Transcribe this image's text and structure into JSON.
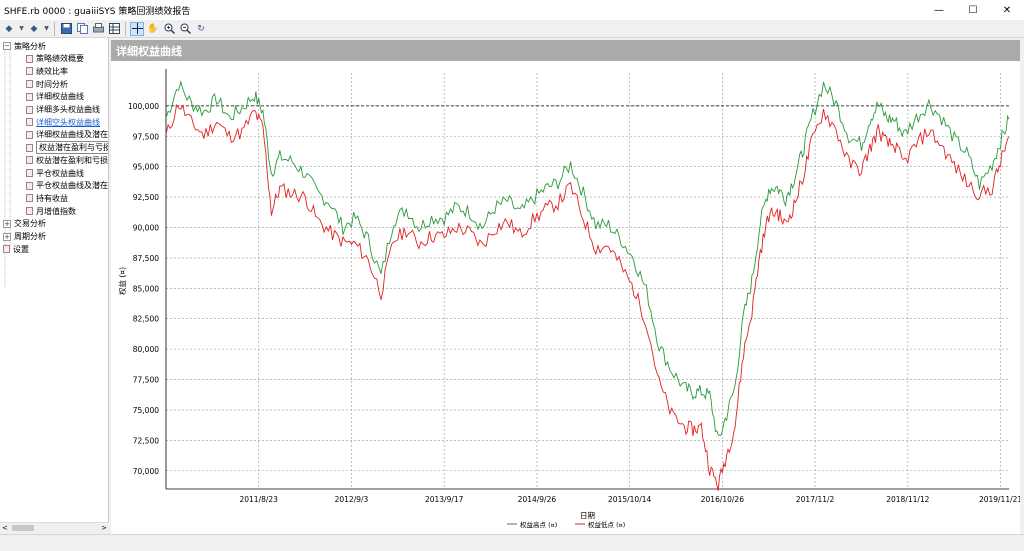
{
  "window": {
    "title": "SHFE.rb 0000 : guaiiiSYS 策略回测绩效报告",
    "minimize": "—",
    "maximize": "☐",
    "close": "✕"
  },
  "toolbar": {
    "icons": [
      "back-arrow-icon",
      "dropdown-icon",
      "forward-arrow-icon",
      "dropdown-icon",
      "save-icon",
      "copy-icon",
      "print-icon",
      "table-icon",
      "crosshair-icon",
      "hand-pan-icon",
      "zoom-in-icon",
      "zoom-out-icon",
      "refresh-icon"
    ]
  },
  "tree": {
    "items": [
      {
        "label": "策略分析",
        "level": 0,
        "expander": "−"
      },
      {
        "label": "策略绩效概要",
        "level": 1
      },
      {
        "label": "绩效比率",
        "level": 1
      },
      {
        "label": "时间分析",
        "level": 1
      },
      {
        "label": "详细权益曲线",
        "level": 1
      },
      {
        "label": "详细多头权益曲线",
        "level": 1
      },
      {
        "label": "详细空头权益曲线",
        "level": 1,
        "selected": true
      },
      {
        "label": "详细权益曲线及潜在",
        "level": 1
      },
      {
        "label": "权益潜在盈利与亏损",
        "level": 1,
        "hover": true
      },
      {
        "label": "权益潜在盈利和亏损",
        "level": 1
      },
      {
        "label": "平仓权益曲线",
        "level": 1
      },
      {
        "label": "平仓权益曲线及潜在",
        "level": 1
      },
      {
        "label": "持有收益",
        "level": 1
      },
      {
        "label": "月增值指数",
        "level": 1
      },
      {
        "label": "交易分析",
        "level": 0,
        "expander": "+"
      },
      {
        "label": "周期分析",
        "level": 0,
        "expander": "+"
      },
      {
        "label": "设置",
        "level": 0
      }
    ]
  },
  "panel": {
    "title": "详细权益曲线"
  },
  "chart_data": {
    "type": "line",
    "title": "",
    "xlabel": "日期",
    "ylabel": "权益 (¤)",
    "ylim": [
      68500,
      102700
    ],
    "yticks": [
      "70,000",
      "72,500",
      "75,000",
      "77,500",
      "80,000",
      "82,500",
      "85,000",
      "87,500",
      "90,000",
      "92,500",
      "95,000",
      "97,500",
      "100,000"
    ],
    "ytick_values": [
      70000,
      72500,
      75000,
      77500,
      80000,
      82500,
      85000,
      87500,
      90000,
      92500,
      95000,
      97500,
      100000
    ],
    "xticks": [
      "2011/8/23",
      "2012/9/3",
      "2013/9/17",
      "2014/9/26",
      "2015/10/14",
      "2016/10/26",
      "2017/11/2",
      "2018/11/12",
      "2019/11/21"
    ],
    "xtick_fractions": [
      0.11,
      0.22,
      0.33,
      0.44,
      0.55,
      0.66,
      0.77,
      0.88,
      0.99
    ],
    "reference_line": 100000,
    "grid": true,
    "legend_position": "bottom",
    "series": [
      {
        "name": "权益高点 (¤)",
        "color": "#2a9a3a"
      },
      {
        "name": "权益低点 (¤)",
        "color": "#e02020"
      }
    ],
    "x": [
      0,
      0.015,
      0.03,
      0.045,
      0.06,
      0.075,
      0.09,
      0.105,
      0.115,
      0.125,
      0.135,
      0.15,
      0.165,
      0.18,
      0.195,
      0.21,
      0.225,
      0.24,
      0.255,
      0.27,
      0.285,
      0.3,
      0.315,
      0.33,
      0.345,
      0.36,
      0.375,
      0.39,
      0.405,
      0.42,
      0.435,
      0.45,
      0.465,
      0.48,
      0.495,
      0.51,
      0.525,
      0.54,
      0.555,
      0.57,
      0.585,
      0.6,
      0.615,
      0.625,
      0.635,
      0.645,
      0.655,
      0.665,
      0.675,
      0.685,
      0.695,
      0.705,
      0.715,
      0.725,
      0.735,
      0.745,
      0.755,
      0.765,
      0.78,
      0.795,
      0.81,
      0.825,
      0.835,
      0.845,
      0.855,
      0.865,
      0.875,
      0.89,
      0.905,
      0.92,
      0.935,
      0.95,
      0.965,
      0.98,
      0.99,
      1.0
    ],
    "high": [
      99000,
      101800,
      100200,
      99500,
      100600,
      99000,
      99800,
      100900,
      99500,
      94500,
      95800,
      95400,
      94400,
      92800,
      92000,
      90000,
      90800,
      89000,
      86000,
      90600,
      91500,
      90000,
      90800,
      90800,
      91700,
      91300,
      90000,
      91600,
      92200,
      91200,
      92300,
      93200,
      93700,
      95200,
      92800,
      90200,
      90200,
      89000,
      87400,
      84800,
      80300,
      78200,
      76800,
      76400,
      76500,
      76200,
      72400,
      74600,
      76900,
      82700,
      85600,
      90400,
      93200,
      93300,
      92400,
      94000,
      96200,
      98800,
      101800,
      100200,
      97500,
      96800,
      98900,
      100100,
      99000,
      98800,
      97600,
      99000,
      100200,
      99000,
      97300,
      96100,
      93500,
      95200,
      97100,
      98900
    ],
    "low": [
      97500,
      100200,
      98600,
      97600,
      98700,
      97500,
      97800,
      99500,
      98200,
      91300,
      93200,
      92800,
      92500,
      90600,
      89600,
      88800,
      88600,
      87300,
      84600,
      88900,
      89800,
      88700,
      89300,
      89300,
      90000,
      89600,
      88500,
      89900,
      90500,
      89400,
      90600,
      91500,
      92000,
      93400,
      90800,
      88300,
      88500,
      86800,
      84900,
      82200,
      77200,
      74600,
      73600,
      73400,
      73600,
      70200,
      68800,
      71300,
      73700,
      79700,
      83100,
      88000,
      91000,
      91300,
      90200,
      91800,
      94000,
      96800,
      99600,
      98000,
      95300,
      94700,
      96500,
      98000,
      96900,
      96700,
      95300,
      96800,
      98000,
      96700,
      95100,
      93700,
      92700,
      93200,
      95400,
      97500
    ]
  }
}
